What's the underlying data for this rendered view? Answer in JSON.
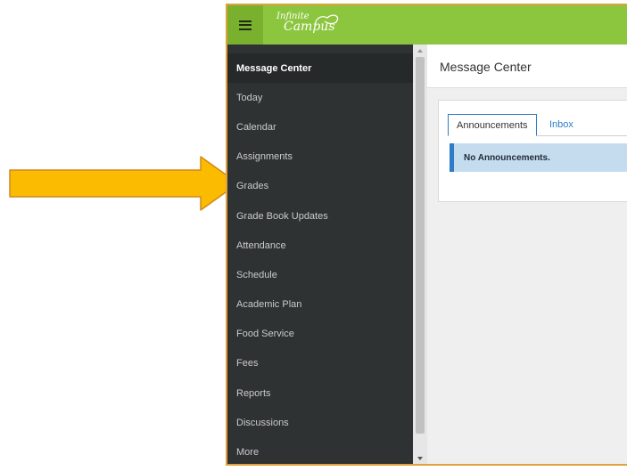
{
  "app": {
    "logo_line1": "Infinite",
    "logo_line2": "Campus"
  },
  "sidebar": {
    "items": [
      {
        "label": "Message Center",
        "active": true
      },
      {
        "label": "Today"
      },
      {
        "label": "Calendar"
      },
      {
        "label": "Assignments"
      },
      {
        "label": "Grades"
      },
      {
        "label": "Grade Book Updates"
      },
      {
        "label": "Attendance"
      },
      {
        "label": "Schedule"
      },
      {
        "label": "Academic Plan"
      },
      {
        "label": "Food Service"
      },
      {
        "label": "Fees"
      },
      {
        "label": "Reports"
      },
      {
        "label": "Discussions"
      },
      {
        "label": "More"
      }
    ]
  },
  "main": {
    "title": "Message Center",
    "tabs": [
      {
        "label": "Announcements",
        "active": true
      },
      {
        "label": "Inbox"
      }
    ],
    "notice": "No Announcements."
  },
  "annotation": {
    "arrow_color": "#fbbb00",
    "arrow_stroke": "#d08a1a",
    "points_to": "Grades"
  },
  "colors": {
    "topbar": "#8cc63f",
    "sidebar": "#2f3233",
    "accent": "#2e7cc4"
  }
}
